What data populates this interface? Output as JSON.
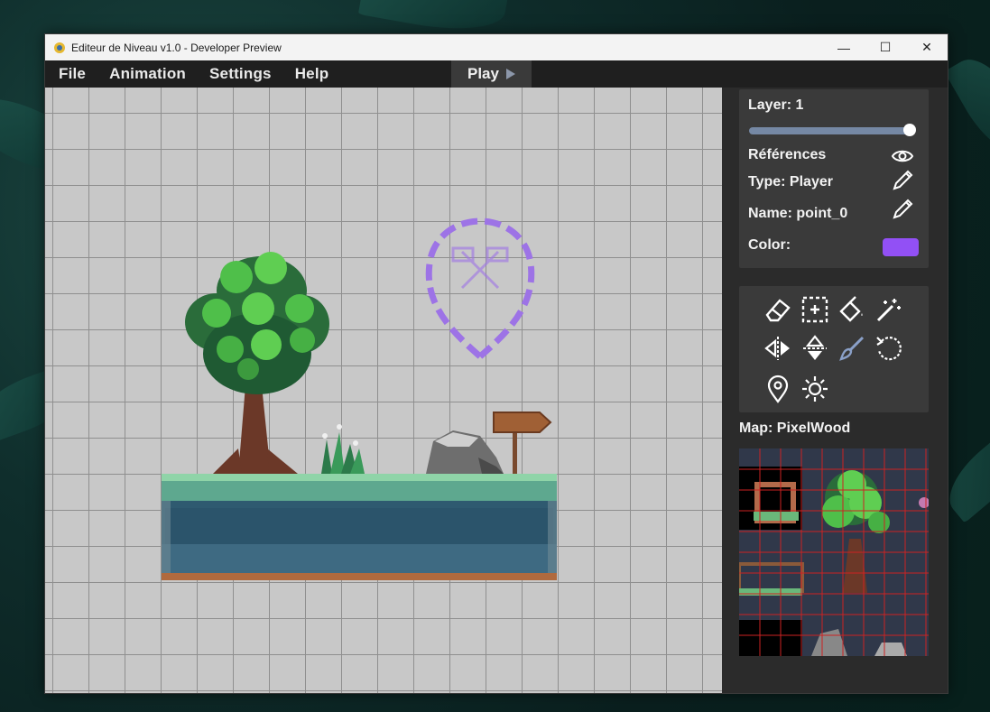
{
  "window": {
    "title": "Editeur de Niveau v1.0 - Developer Preview",
    "controls": {
      "minimize": "—",
      "maximize": "☐",
      "close": "✕"
    }
  },
  "menu": {
    "items": [
      "File",
      "Animation",
      "Settings",
      "Help"
    ],
    "play_label": "Play"
  },
  "properties": {
    "layer_label": "Layer: 1",
    "layer_value": 1.0,
    "references_label": "Références",
    "type_label": "Type: Player",
    "name_label": "Name: point_0",
    "color_label": "Color:",
    "color_value": "#9250f5"
  },
  "tools": [
    "eraser-icon",
    "select-icon",
    "fill-icon",
    "magic-wand-icon",
    "flip-horizontal-icon",
    "flip-vertical-icon",
    "brush-icon",
    "rotate-icon",
    "location-pin-icon",
    "light-icon"
  ],
  "map": {
    "label": "Map: PixelWood"
  },
  "colors": {
    "accent": "#9250f5",
    "grid": "#8f8f8f",
    "canvas": "#c8c8c8",
    "panel": "#3a3a3a",
    "slider": "#7588a4"
  }
}
